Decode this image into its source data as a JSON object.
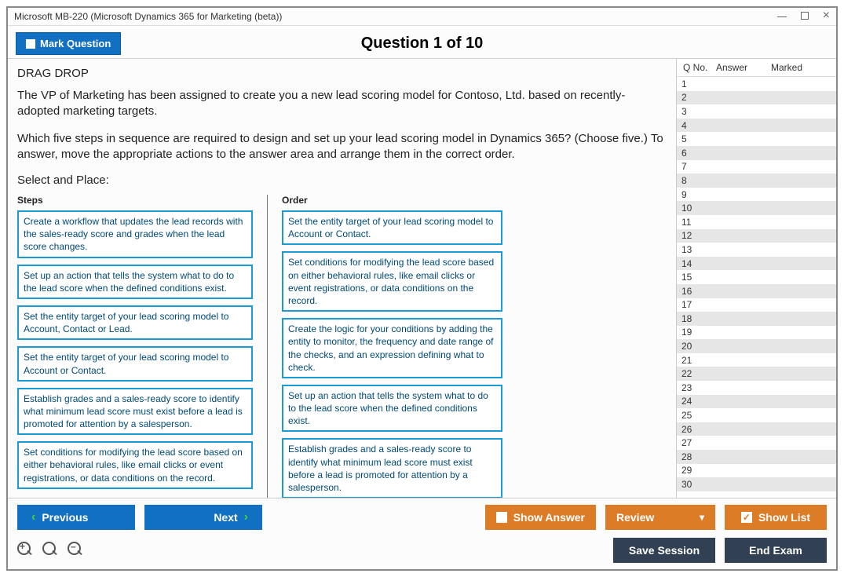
{
  "window": {
    "title": "Microsoft MB-220 (Microsoft Dynamics 365 for Marketing (beta))"
  },
  "toolbar": {
    "mark_label": "Mark Question",
    "question_header": "Question 1 of 10"
  },
  "question": {
    "type_label": "DRAG DROP",
    "paragraph1": "The VP of Marketing has been assigned to create you a new lead scoring model for Contoso, Ltd. based on recently-adopted marketing targets.",
    "paragraph2": "Which five steps in sequence are required to design and set up your lead scoring model in Dynamics 365? (Choose five.) To answer, move the appropriate actions to the answer area and arrange them in the correct order.",
    "select_place": "Select and Place:"
  },
  "dragdrop": {
    "steps_header": "Steps",
    "order_header": "Order",
    "steps": [
      "Create a workflow that updates the lead records with the sales-ready score and grades when the lead score changes.",
      "Set up an action that tells the system what to do to the lead score when the defined conditions exist.",
      "Set the entity target of your lead scoring model to Account, Contact or Lead.",
      "Set the entity target of your lead scoring model to Account or Contact.",
      "Establish grades and a sales-ready score to identify what minimum lead score must exist before a lead is promoted for attention by a salesperson.",
      "Set conditions for modifying the lead score based on either behavioral rules, like email clicks or event registrations, or data conditions on the record."
    ],
    "order": [
      "Set the entity target of your lead scoring model to Account or Contact.",
      "Set conditions for modifying the lead score based on either behavioral rules, like email clicks or event registrations, or data conditions on the record.",
      "Create the logic for your conditions by adding the entity to monitor, the frequency and date range of the checks, and an expression defining what to check.",
      "Set up an action that tells the system what to do to the lead score when the defined conditions exist.",
      "Establish grades and a sales-ready score to identify what minimum lead score must exist before a lead is promoted for attention by a salesperson."
    ]
  },
  "nav": {
    "col_qno": "Q No.",
    "col_answer": "Answer",
    "col_marked": "Marked",
    "rows": [
      "1",
      "2",
      "3",
      "4",
      "5",
      "6",
      "7",
      "8",
      "9",
      "10",
      "11",
      "12",
      "13",
      "14",
      "15",
      "16",
      "17",
      "18",
      "19",
      "20",
      "21",
      "22",
      "23",
      "24",
      "25",
      "26",
      "27",
      "28",
      "29",
      "30"
    ]
  },
  "footer": {
    "previous": "Previous",
    "next": "Next",
    "show_answer": "Show Answer",
    "review": "Review",
    "show_list": "Show List",
    "save_session": "Save Session",
    "end_exam": "End Exam"
  }
}
